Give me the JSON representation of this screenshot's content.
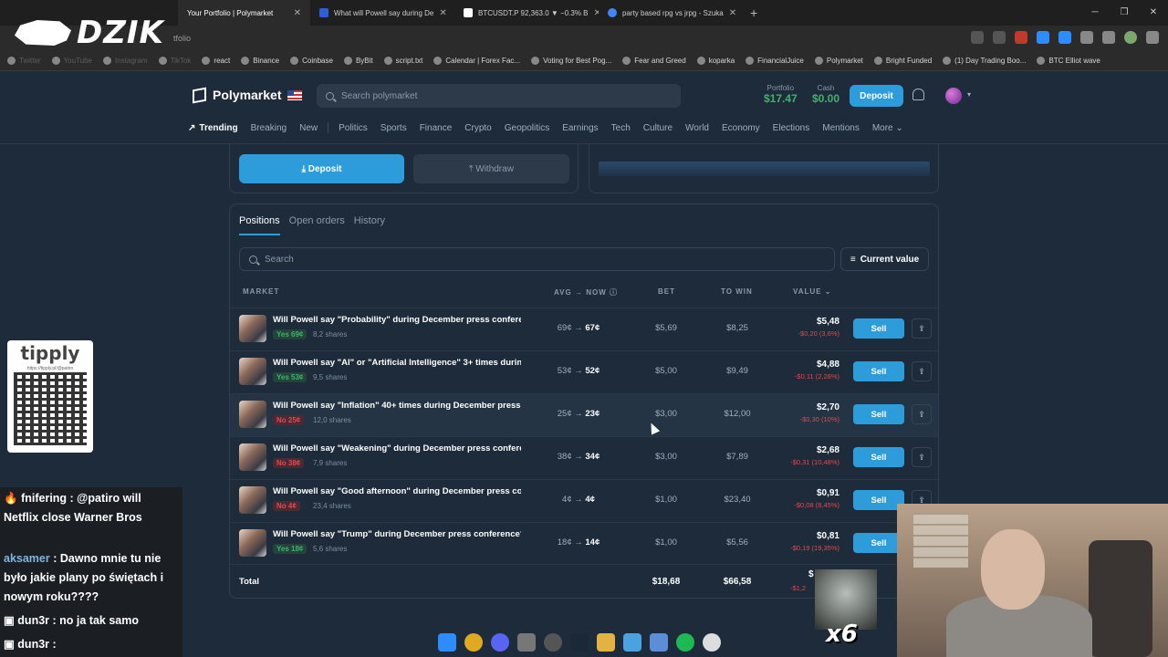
{
  "browser": {
    "tabs": [
      {
        "title": "Your Portfolio | Polymarket",
        "active": true,
        "color": "#2d9cdb"
      },
      {
        "title": "What will Powell say during De",
        "active": false,
        "color": "#2d5fdb"
      },
      {
        "title": "BTCUSDT.P 92,363.0 ▼ −0.3% B",
        "active": false,
        "color": "#ffffff"
      },
      {
        "title": "party based rpg vs jrpg - Szuka",
        "active": false,
        "color": "#4285f4"
      }
    ],
    "url": "tfolio",
    "bookmarks": [
      {
        "label": "Twitter",
        "dim": true
      },
      {
        "label": "YouTube",
        "dim": true
      },
      {
        "label": "Instagram",
        "dim": true
      },
      {
        "label": "TikTok",
        "dim": true
      },
      {
        "label": "react",
        "dim": false
      },
      {
        "label": "Binance",
        "dim": false
      },
      {
        "label": "Coinbase",
        "dim": false
      },
      {
        "label": "ByBit",
        "dim": false
      },
      {
        "label": "script.txt",
        "dim": false
      },
      {
        "label": "Calendar | Forex Fac...",
        "dim": false
      },
      {
        "label": "Voting for Best Pog...",
        "dim": false
      },
      {
        "label": "Fear and Greed",
        "dim": false
      },
      {
        "label": "koparka",
        "dim": false
      },
      {
        "label": "FinancialJuice",
        "dim": false
      },
      {
        "label": "Polymarket",
        "dim": false
      },
      {
        "label": "Bright Funded",
        "dim": false
      },
      {
        "label": "(1) Day Trading Boo...",
        "dim": false
      },
      {
        "label": "BTC Elliot wave",
        "dim": false
      }
    ]
  },
  "overlay_logo": "DZIK",
  "header": {
    "brand": "Polymarket",
    "search_placeholder": "Search polymarket",
    "portfolio_label": "Portfolio",
    "portfolio_value": "$17.47",
    "cash_label": "Cash",
    "cash_value": "$0.00",
    "deposit_label": "Deposit"
  },
  "nav": {
    "trending": "Trending",
    "items": [
      "Breaking",
      "New",
      "Politics",
      "Sports",
      "Finance",
      "Crypto",
      "Geopolitics",
      "Earnings",
      "Tech",
      "Culture",
      "World",
      "Economy",
      "Elections",
      "Mentions",
      "More"
    ]
  },
  "wallet": {
    "deposit": "Deposit",
    "withdraw": "Withdraw"
  },
  "positions": {
    "tabs": [
      "Positions",
      "Open orders",
      "History"
    ],
    "search_placeholder": "Search",
    "sort_label": "Current value",
    "columns": {
      "market": "MARKET",
      "avgnow": "AVG → NOW",
      "bet": "BET",
      "towin": "TO WIN",
      "value": "VALUE"
    },
    "rows": [
      {
        "title": "Will Powell say \"Probability\" during December press conferen...",
        "side": "Yes 69¢",
        "outcome": "yes",
        "shares": "8,2 shares",
        "avg": "69¢",
        "now": "67¢",
        "bet": "$5,69",
        "towin": "$8,25",
        "value": "$5,48",
        "change": "-$0,20 (3,6%)",
        "sell": "Sell"
      },
      {
        "title": "Will Powell say \"AI\" or \"Artificial Intelligence\" 3+ times during ...",
        "side": "Yes 53¢",
        "outcome": "yes",
        "shares": "9,5 shares",
        "avg": "53¢",
        "now": "52¢",
        "bet": "$5,00",
        "towin": "$9,49",
        "value": "$4,88",
        "change": "-$0,11 (2,28%)",
        "sell": "Sell"
      },
      {
        "title": "Will Powell say \"Inflation\" 40+ times during December press c...",
        "side": "No 25¢",
        "outcome": "no",
        "shares": "12,0 shares",
        "avg": "25¢",
        "now": "23¢",
        "bet": "$3,00",
        "towin": "$12,00",
        "value": "$2,70",
        "change": "-$0,30 (10%)",
        "sell": "Sell"
      },
      {
        "title": "Will Powell say \"Weakening\" during December press conferen...",
        "side": "No 38¢",
        "outcome": "no",
        "shares": "7,9 shares",
        "avg": "38¢",
        "now": "34¢",
        "bet": "$3,00",
        "towin": "$7,89",
        "value": "$2,68",
        "change": "-$0,31 (10,48%)",
        "sell": "Sell"
      },
      {
        "title": "Will Powell say \"Good afternoon\" during December press conf...",
        "side": "No 4¢",
        "outcome": "no",
        "shares": "23,4 shares",
        "avg": "4¢",
        "now": "4¢",
        "bet": "$1,00",
        "towin": "$23,40",
        "value": "$0,91",
        "change": "-$0,08 (8,45%)",
        "sell": "Sell"
      },
      {
        "title": "Will Powell say \"Trump\" during December press conference?",
        "side": "Yes 18¢",
        "outcome": "yes",
        "shares": "5,6 shares",
        "avg": "18¢",
        "now": "14¢",
        "bet": "$1,00",
        "towin": "$5,56",
        "value": "$0,81",
        "change": "-$0,19 (19,35%)",
        "sell": "Sell"
      }
    ],
    "total": {
      "label": "Total",
      "bet": "$18,68",
      "towin": "$66,58",
      "value": "$",
      "change": "-$1,2"
    }
  },
  "stream": {
    "tipply_title": "tipply",
    "tipply_url": "https://tipply.pl/@patiro",
    "chat": [
      {
        "user": "fnifering",
        "text": ": @patiro will Netflix close Warner Bros"
      },
      {
        "user": "aksamer",
        "text": ": Dawno mnie tu nie było jakie plany po świętach i nowym roku????"
      },
      {
        "user": "dun3r",
        "text": ": no ja tak samo"
      },
      {
        "user": "dun3r",
        "text": ":"
      }
    ],
    "multiplier": "x6"
  }
}
